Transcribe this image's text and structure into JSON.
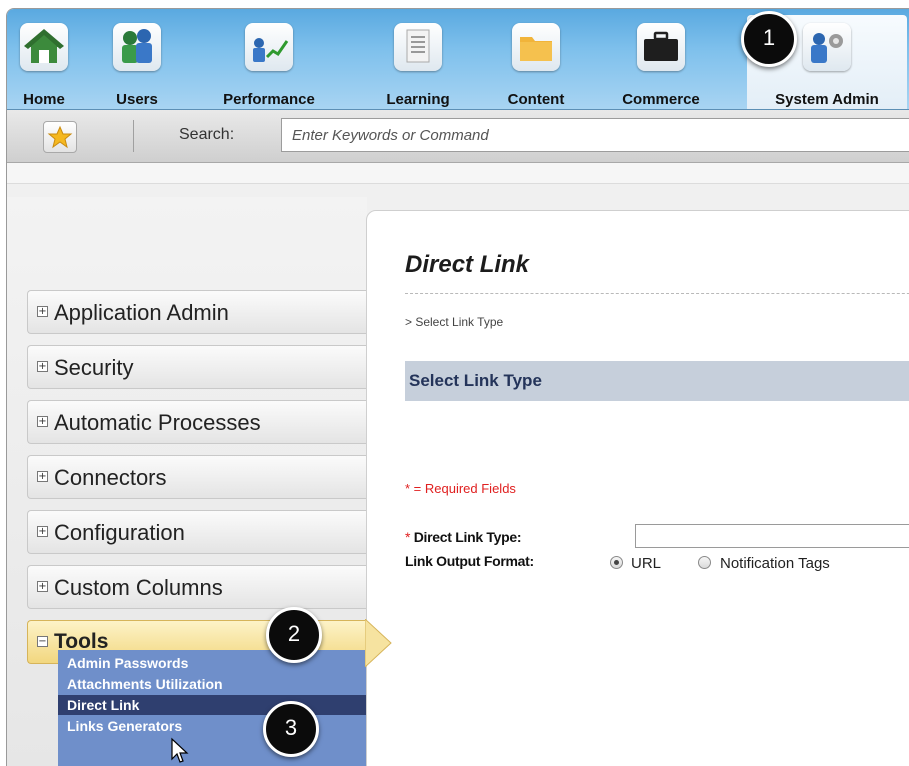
{
  "nav": {
    "items": [
      {
        "label": "Home",
        "icon": "home-icon"
      },
      {
        "label": "Users",
        "icon": "users-icon"
      },
      {
        "label": "Performance",
        "icon": "performance-icon"
      },
      {
        "label": "Learning",
        "icon": "learning-icon"
      },
      {
        "label": "Content",
        "icon": "folder-icon"
      },
      {
        "label": "Commerce",
        "icon": "briefcase-icon"
      },
      {
        "label": "System Admin",
        "icon": "admin-gear-icon",
        "active": true
      }
    ]
  },
  "search": {
    "label": "Search:",
    "placeholder": "Enter Keywords or Command",
    "favorites_icon": "star-icon"
  },
  "sidebar": {
    "sections": [
      {
        "label": "Application Admin",
        "expanded": false
      },
      {
        "label": "Security",
        "expanded": false
      },
      {
        "label": "Automatic Processes",
        "expanded": false
      },
      {
        "label": "Connectors",
        "expanded": false
      },
      {
        "label": "Configuration",
        "expanded": false
      },
      {
        "label": "Custom Columns",
        "expanded": false
      },
      {
        "label": "Tools",
        "expanded": true
      }
    ],
    "expand_glyph": "+",
    "collapse_glyph": "−",
    "tools_items": [
      {
        "label": "Admin Passwords"
      },
      {
        "label": "Attachments Utilization"
      },
      {
        "label": "Direct Link",
        "active": true
      },
      {
        "label": "Links Generators"
      }
    ]
  },
  "main": {
    "title": "Direct Link",
    "breadcrumb": "> Select Link Type",
    "section_header": "Select Link Type",
    "required_note": "* = Required Fields",
    "fields": {
      "link_type_star": "*",
      "link_type_label": "Direct Link Type:",
      "link_type_value": "",
      "output_format_label": "Link Output Format:",
      "options": [
        {
          "label": "URL",
          "selected": true
        },
        {
          "label": "Notification Tags",
          "selected": false
        }
      ]
    }
  },
  "callouts": [
    "1",
    "2",
    "3"
  ],
  "colors": {
    "nav_gradient_top": "#5aa9e0",
    "tools_highlight": "#f2d77f",
    "submenu_bg": "#6f8fca",
    "submenu_active": "#2f3f6f",
    "section_header_bg": "#c6cfdb",
    "required_red": "#e02020"
  }
}
